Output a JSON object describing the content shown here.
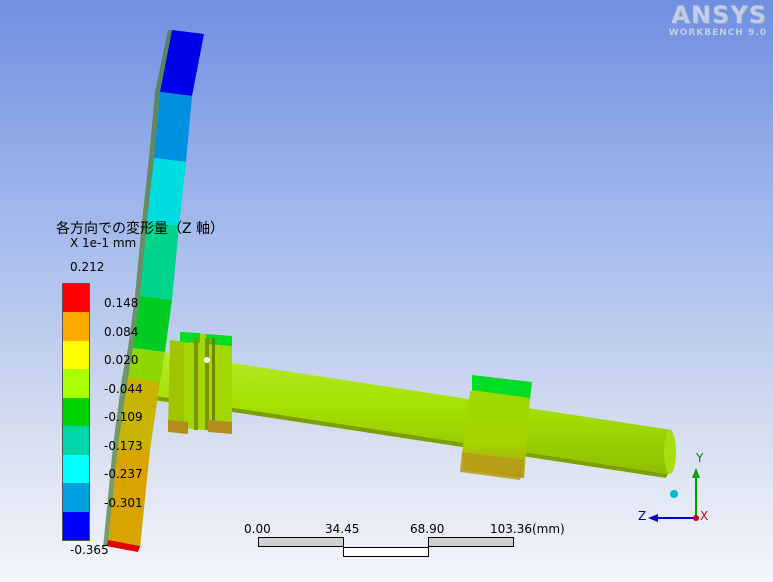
{
  "logo": {
    "brand": "ANSYS",
    "product": "WORKBENCH 9.0"
  },
  "legend": {
    "title": "各方向での変形量（Z 軸）",
    "unit": "X 1e-1 mm",
    "max": "0.212",
    "labels": [
      "0.148",
      "0.084",
      "0.020",
      "-0.044",
      "-0.109",
      "-0.173",
      "-0.237",
      "-0.301"
    ],
    "min": "-0.365",
    "colors": [
      "#ff0000",
      "#ffaa00",
      "#ffff00",
      "#aaff00",
      "#00d400",
      "#00d4aa",
      "#00ffff",
      "#00a0e0",
      "#0000ff"
    ]
  },
  "scale": {
    "ticks": [
      "0.00",
      "34.45",
      "68.90",
      "103.36"
    ],
    "unit": "(mm)"
  },
  "triad": {
    "y": "Y",
    "z": "Z",
    "x": "X"
  }
}
